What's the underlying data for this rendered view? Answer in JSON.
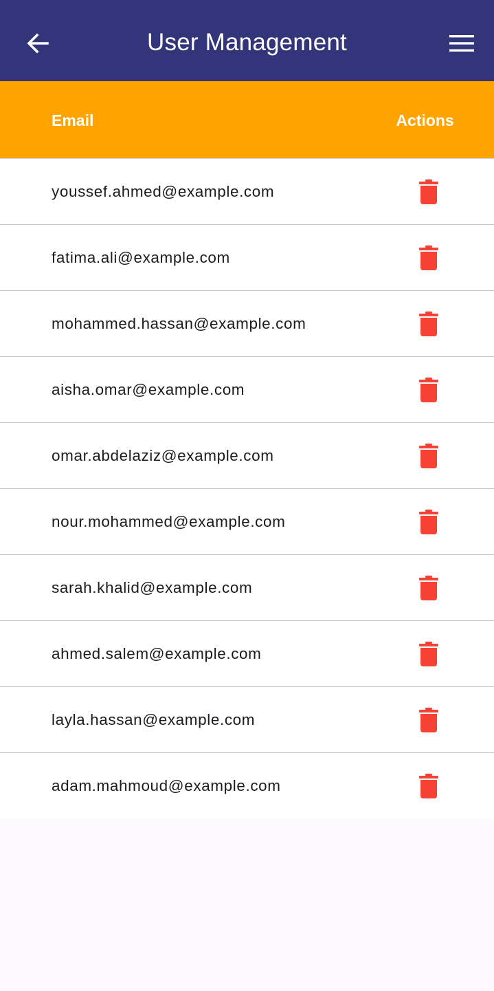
{
  "appbar": {
    "title": "User Management",
    "back_icon": "arrow-back-icon",
    "menu_icon": "hamburger-menu-icon",
    "background_color": "#33357a"
  },
  "table": {
    "header_color": "#ffa300",
    "columns": [
      "Email",
      "Actions"
    ],
    "rows": [
      {
        "email": "youssef.ahmed@example.com",
        "action_icon": "trash-icon"
      },
      {
        "email": "fatima.ali@example.com",
        "action_icon": "trash-icon"
      },
      {
        "email": "mohammed.hassan@example.com",
        "action_icon": "trash-icon"
      },
      {
        "email": "aisha.omar@example.com",
        "action_icon": "trash-icon"
      },
      {
        "email": "omar.abdelaziz@example.com",
        "action_icon": "trash-icon"
      },
      {
        "email": "nour.mohammed@example.com",
        "action_icon": "trash-icon"
      },
      {
        "email": "sarah.khalid@example.com",
        "action_icon": "trash-icon"
      },
      {
        "email": "ahmed.salem@example.com",
        "action_icon": "trash-icon"
      },
      {
        "email": "layla.hassan@example.com",
        "action_icon": "trash-icon"
      },
      {
        "email": "adam.mahmoud@example.com",
        "action_icon": "trash-icon"
      }
    ],
    "delete_color": "#f44336"
  }
}
